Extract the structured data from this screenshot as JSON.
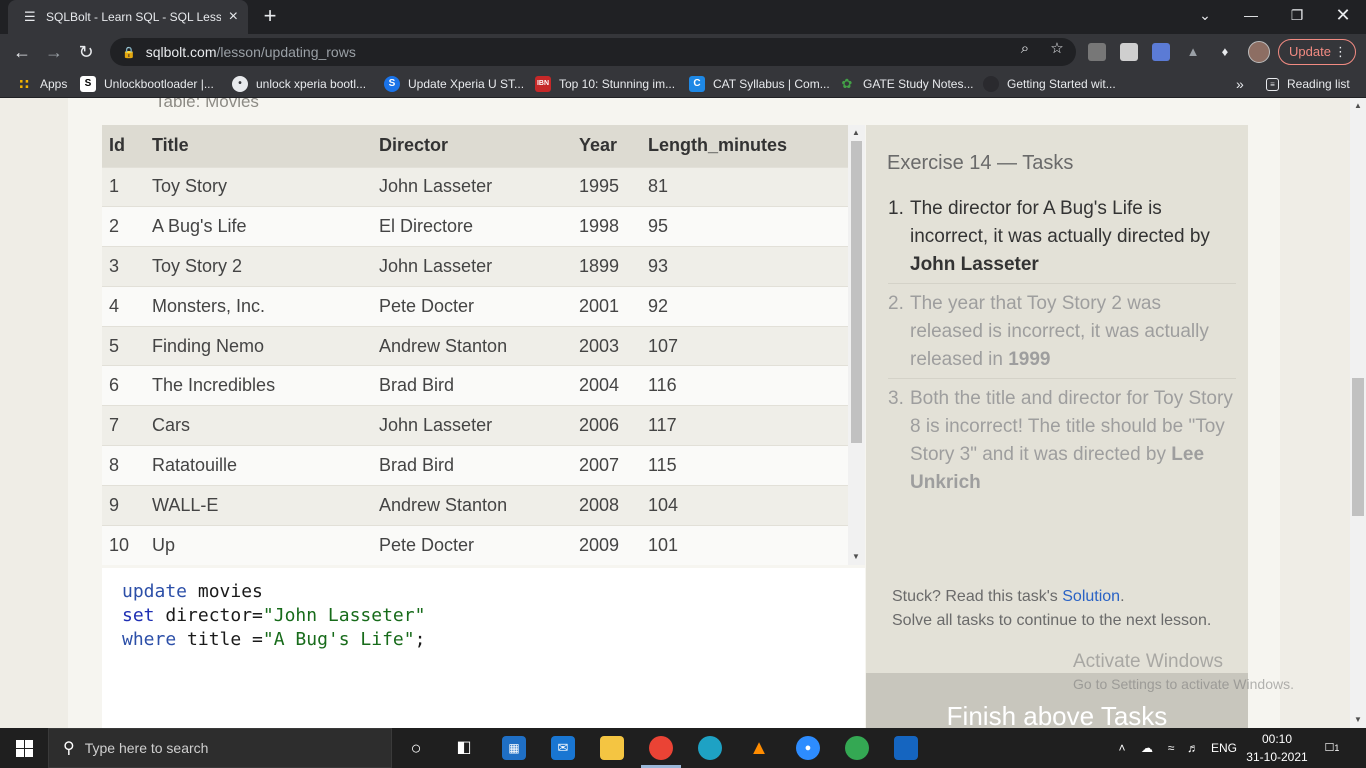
{
  "browser": {
    "tab_title": "SQLBolt - Learn SQL - SQL Lesson",
    "url_host": "sqlbolt.com",
    "url_path": "/lesson/updating_rows",
    "update_label": "Update",
    "bookmarks": [
      {
        "label": "Apps",
        "icon": "apps-grid-icon"
      },
      {
        "label": "Unlockbootloader |...",
        "icon": "s-icon"
      },
      {
        "label": "unlock xperia bootl...",
        "icon": "globe-icon"
      },
      {
        "label": "Update Xperia U ST...",
        "icon": "s-icon"
      },
      {
        "label": "Top 10: Stunning im...",
        "icon": "ibn-icon"
      },
      {
        "label": "CAT Syllabus | Com...",
        "icon": "c-icon"
      },
      {
        "label": "GATE Study Notes...",
        "icon": "leaf-icon"
      },
      {
        "label": "Getting Started wit...",
        "icon": "globe-icon"
      }
    ],
    "reading_list_label": "Reading list"
  },
  "lesson": {
    "table_label": "Table: Movies",
    "columns": [
      "Id",
      "Title",
      "Director",
      "Year",
      "Length_minutes"
    ],
    "rows": [
      [
        "1",
        "Toy Story",
        "John Lasseter",
        "1995",
        "81"
      ],
      [
        "2",
        "A Bug's Life",
        "El Directore",
        "1998",
        "95"
      ],
      [
        "3",
        "Toy Story 2",
        "John Lasseter",
        "1899",
        "93"
      ],
      [
        "4",
        "Monsters, Inc.",
        "Pete Docter",
        "2001",
        "92"
      ],
      [
        "5",
        "Finding Nemo",
        "Andrew Stanton",
        "2003",
        "107"
      ],
      [
        "6",
        "The Incredibles",
        "Brad Bird",
        "2004",
        "116"
      ],
      [
        "7",
        "Cars",
        "John Lasseter",
        "2006",
        "117"
      ],
      [
        "8",
        "Ratatouille",
        "Brad Bird",
        "2007",
        "115"
      ],
      [
        "9",
        "WALL-E",
        "Andrew Stanton",
        "2008",
        "104"
      ],
      [
        "10",
        "Up",
        "Pete Docter",
        "2009",
        "101"
      ]
    ],
    "editor": {
      "line1_kw": "update",
      "line1_rest": " movies",
      "line2_kw": "set",
      "line2_mid": " director=",
      "line2_str": "\"John Lasseter\"",
      "line3_kw": "where",
      "line3_mid": " title =",
      "line3_str": "\"A Bug's Life\"",
      "line3_end": ";"
    },
    "tasks_title": "Exercise 14 — Tasks",
    "tasks": [
      {
        "num": "1.",
        "text": "The director for A Bug's Life is incorrect, it was actually directed by ",
        "bold": "John Lasseter",
        "state": "active"
      },
      {
        "num": "2.",
        "text": "The year that Toy Story 2 was released is incorrect, it was actually released in ",
        "bold": "1999",
        "state": "done"
      },
      {
        "num": "3.",
        "text": "Both the title and director for Toy Story 8 is incorrect! The title should be \"Toy Story 3\" and it was directed by ",
        "bold": "Lee Unkrich",
        "state": "done"
      }
    ],
    "stuck_prefix": "Stuck? Read this task's ",
    "solution_link": "Solution",
    "stuck_suffix": ".",
    "solve_all": "Solve all tasks to continue to the next lesson.",
    "finish_label": "Finish above Tasks"
  },
  "watermark": {
    "line1": "Activate Windows",
    "line2": "Go to Settings to activate Windows."
  },
  "taskbar": {
    "search_placeholder": "Type here to search",
    "lang": "ENG",
    "time": "00:10",
    "date": "31-10-2021",
    "notification_count": "1"
  },
  "colors": {
    "accent_link": "#2962c5",
    "update_red": "#f28b82",
    "task_active": "#333333",
    "task_done": "#9e9e9e"
  }
}
